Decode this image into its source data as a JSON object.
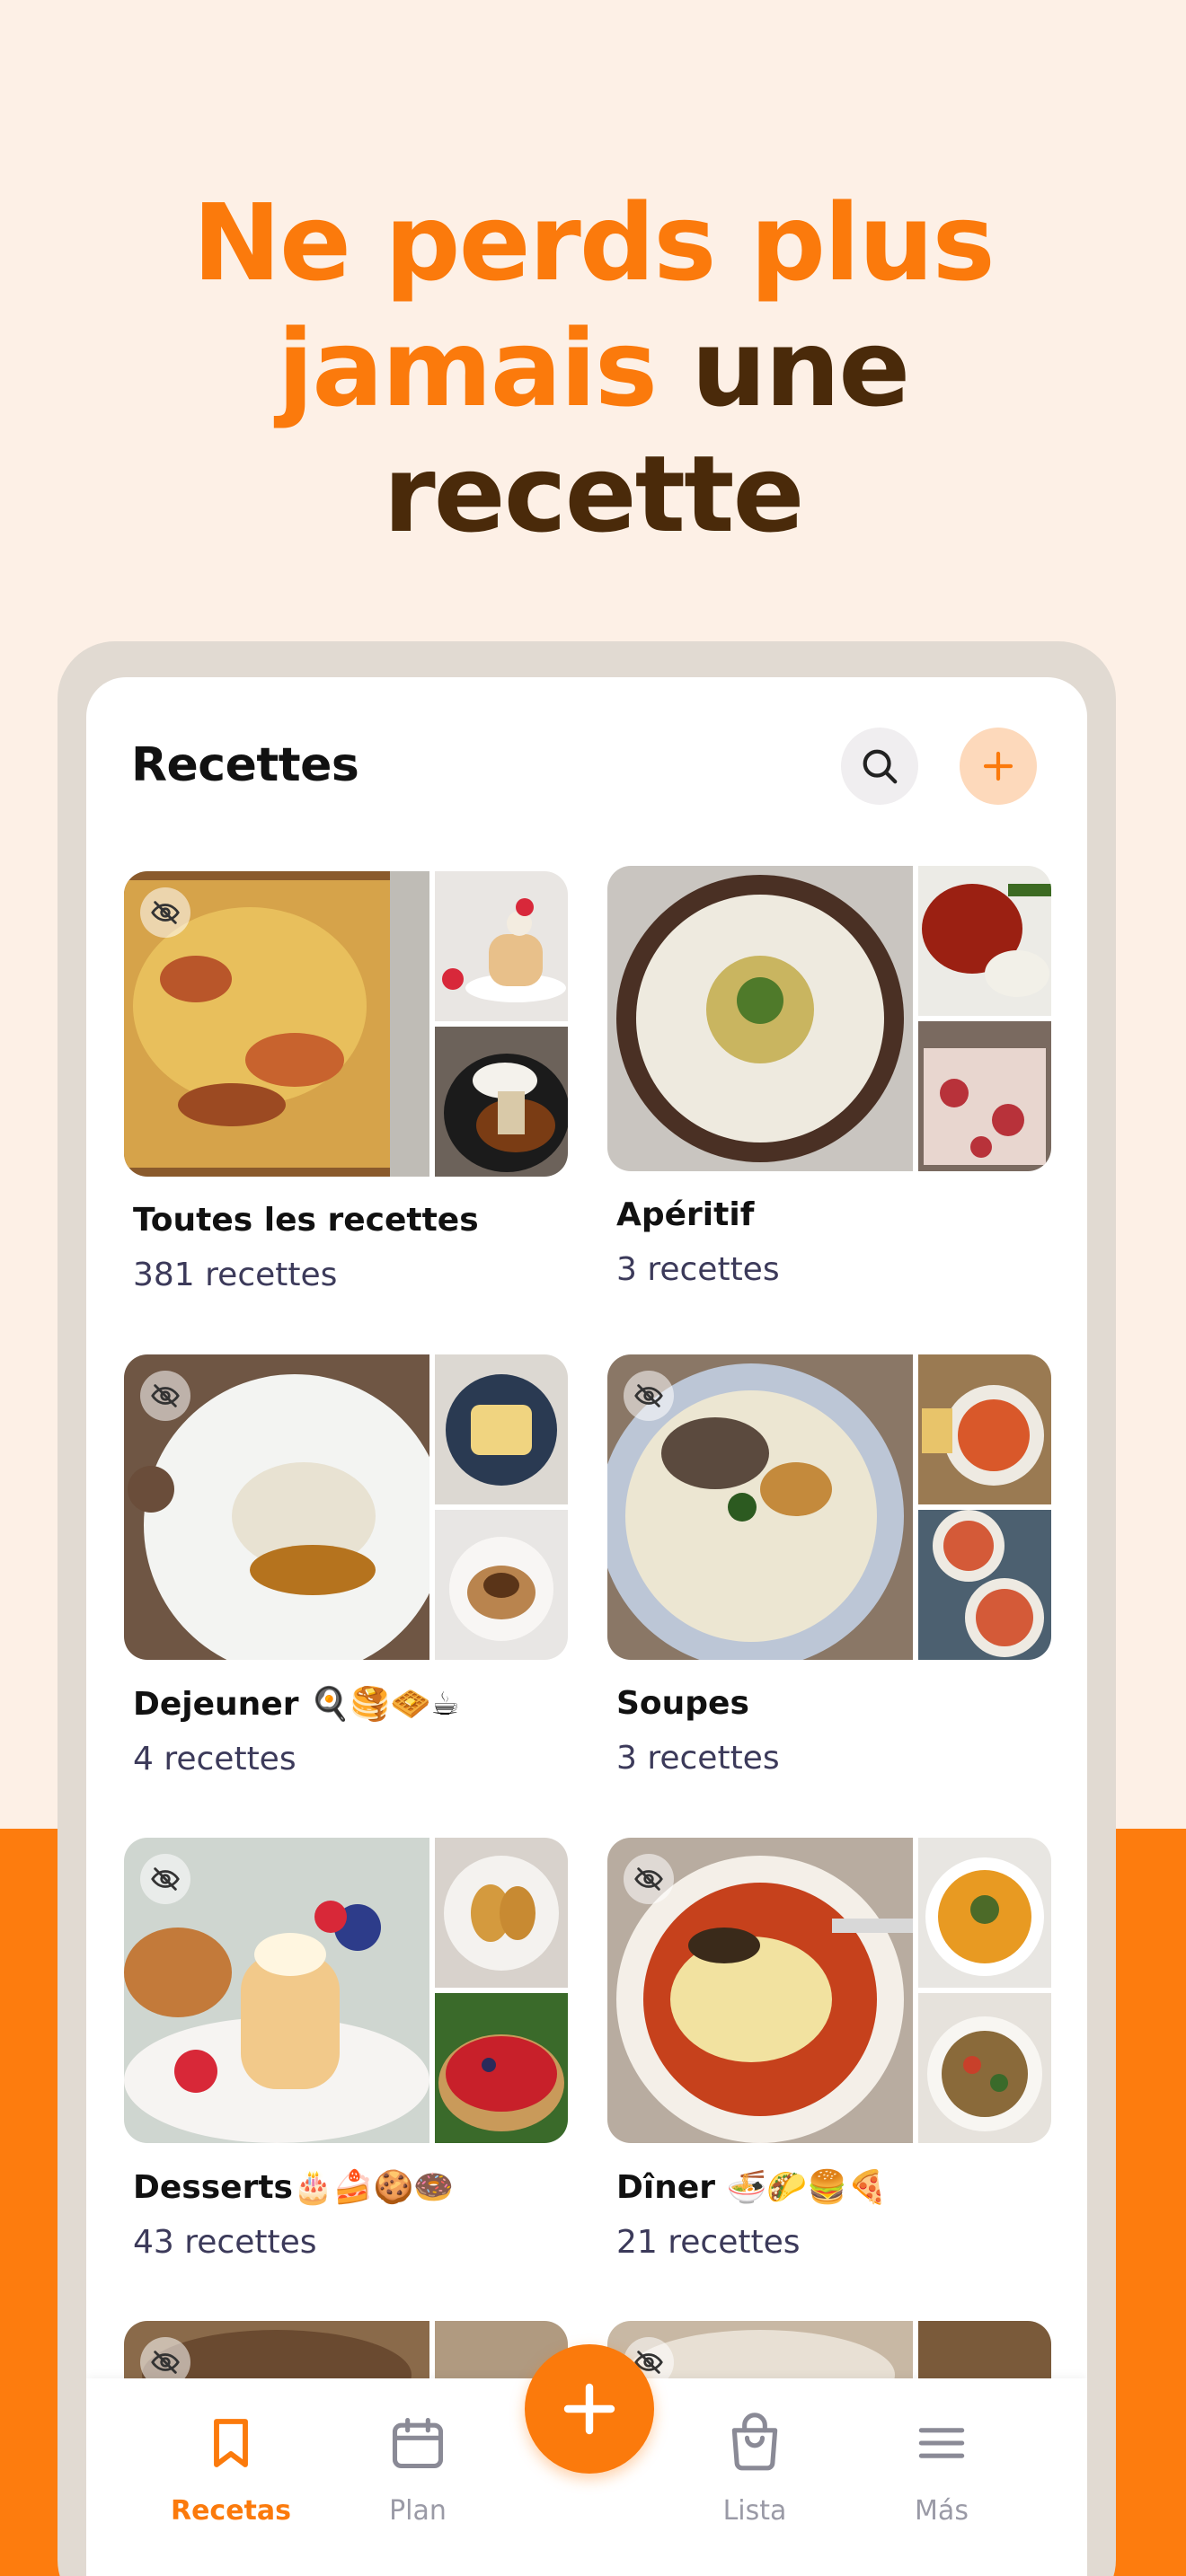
{
  "headline": {
    "line1": "Ne perds plus",
    "line2_accent": "jamais",
    "line2_rest": "une",
    "line3": "recette"
  },
  "colors": {
    "accent": "#fb7a0c",
    "dark_brown": "#4a2a0a",
    "page_bg": "#fdf0e6",
    "orange_band": "#fd7c0e"
  },
  "app": {
    "title": "Recettes",
    "search_icon": "search-icon",
    "add_icon": "plus-icon"
  },
  "collections": [
    {
      "name": "Toutes les recettes",
      "count": "381 recettes",
      "hidden": true
    },
    {
      "name": "Apéritif",
      "count": "3  recettes",
      "hidden": false
    },
    {
      "name": "Dejeuner  🍳🥞🧇☕",
      "count": "4  recettes",
      "hidden": true
    },
    {
      "name": "Soupes",
      "count": "3  recettes",
      "hidden": true
    },
    {
      "name": "Desserts🎂🍰🍪🍩",
      "count": "43  recettes",
      "hidden": true
    },
    {
      "name": "Dîner   🍜🌮🍔🍕",
      "count": "21  recettes",
      "hidden": true
    },
    {
      "name": "",
      "count": "",
      "hidden": true
    },
    {
      "name": "",
      "count": "",
      "hidden": true
    }
  ],
  "nav": {
    "items": [
      {
        "label": "Recetas",
        "icon": "bookmark-icon",
        "active": true
      },
      {
        "label": "Plan",
        "icon": "calendar-icon",
        "active": false
      },
      {
        "label": "Lista",
        "icon": "shopping-bag-icon",
        "active": false
      },
      {
        "label": "Más",
        "icon": "menu-icon",
        "active": false
      }
    ],
    "fab_icon": "plus-icon"
  }
}
